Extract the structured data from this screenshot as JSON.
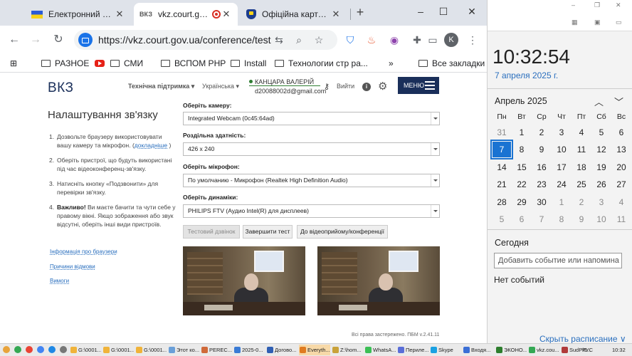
{
  "browser": {
    "tabs": [
      {
        "title": "Електронний суд",
        "close": "✕"
      },
      {
        "title": "vkz.court.gov.ua",
        "favicon": "ВКЗ",
        "close": "✕"
      },
      {
        "title": "Офіційна карта по",
        "close": "✕"
      }
    ],
    "new_tab": "+",
    "url": "https://vkz.court.gov.ua/conference/test",
    "profile_initial": "K",
    "bookmarks": [
      "РАЗНОЕ",
      "СМИ",
      "ВСПОМ PHP",
      "Install",
      "Технологии стр ра...",
      "Все закладки"
    ],
    "bookmarks_overflow": "»",
    "window_controls": {
      "minimize": "–",
      "maximize": "☐",
      "close": "✕"
    }
  },
  "site": {
    "logo": "ВКЗ",
    "support": "Технічна підтримка ▾",
    "language": "Українська ▾",
    "user_name": "КАНЦАРА ВАЛЕРІЙ",
    "user_email": "d20088002d@gmail.com",
    "logout": "Вийти",
    "info": "i",
    "menu": "МЕНЮ",
    "page_title": "Налаштування зв'язку",
    "steps": [
      {
        "num": "1.",
        "text": "Дозвольте браузеру використовувати вашу камеру та мікрофон. (",
        "link": "докладніше",
        "tail": " )"
      },
      {
        "num": "2.",
        "text": "Оберіть пристрої, що будуть використані під час відеоконференц-зв'язку."
      },
      {
        "num": "3.",
        "text": "Натисніть кнопку «Подзвонити» для перевірки зв'язку."
      },
      {
        "num": "4.",
        "bold": "Важливо!",
        "text": " Ви маєте бачити та чути себе у правому вікні. Якщо зображення або звук відсутні, оберіть інші види пристроїв."
      }
    ],
    "side_links": [
      "Інформація про браузери",
      "Причини відмови",
      "Вимоги"
    ],
    "fields": [
      {
        "label": "Оберіть камеру:",
        "value": "Integrated Webcam (0c45:64ad)"
      },
      {
        "label": "Роздільна здатність:",
        "value": "426 x 240"
      },
      {
        "label": "Оберіть мікрофон:",
        "value": "По умолчанию - Микрофон (Realtek High Definition Audio)"
      },
      {
        "label": "Оберіть динаміки:",
        "value": "PHILIPS FTV (Аудио Intel(R) для дисплеев)"
      }
    ],
    "buttons": {
      "test_call": "Тестовий дзвінок",
      "end_test": "Завершити тест",
      "to_conference": "До відеоприйому/конференції"
    },
    "footer": "Всі права застережено. ПБМ v.2.41.11"
  },
  "calendar": {
    "time": "10:32:54",
    "date": "7 апреля 2025 г.",
    "month": "Апрель 2025",
    "nav_up": "︿",
    "nav_down": "﹀",
    "weekdays": [
      "Пн",
      "Вт",
      "Ср",
      "Чт",
      "Пт",
      "Сб",
      "Вс"
    ],
    "weeks": [
      [
        "31",
        "1",
        "2",
        "3",
        "4",
        "5",
        "6"
      ],
      [
        "7",
        "8",
        "9",
        "10",
        "11",
        "12",
        "13"
      ],
      [
        "14",
        "15",
        "16",
        "17",
        "18",
        "19",
        "20"
      ],
      [
        "21",
        "22",
        "23",
        "24",
        "25",
        "26",
        "27"
      ],
      [
        "28",
        "29",
        "30",
        "1",
        "2",
        "3",
        "4"
      ],
      [
        "5",
        "6",
        "7",
        "8",
        "9",
        "10",
        "11"
      ]
    ],
    "today_label": "Сегодня",
    "add_event_placeholder": "Добавить событие или напомина",
    "no_events": "Нет событий",
    "hide_schedule": "Скрыть расписание ∨"
  },
  "taskbar": {
    "items": [
      "G:\\0001...",
      "G:\\0001...",
      "G:\\0001...",
      "Этот ко...",
      "PEREC...",
      "2025-0...",
      "Догово...",
      "Everyth...",
      "Z:\\hom...",
      "WhatsA...",
      "Периле...",
      "Skype",
      "Входя...",
      "ЭКОНО...",
      "vkz.cou...",
      "SudPl6..."
    ],
    "lang": "РУС",
    "clock": "10:32"
  },
  "colors": {
    "brand_navy": "#1a2f5a",
    "link_blue": "#2a6fbe",
    "calendar_today": "#1a73d2",
    "online_green": "#2e7d32"
  }
}
